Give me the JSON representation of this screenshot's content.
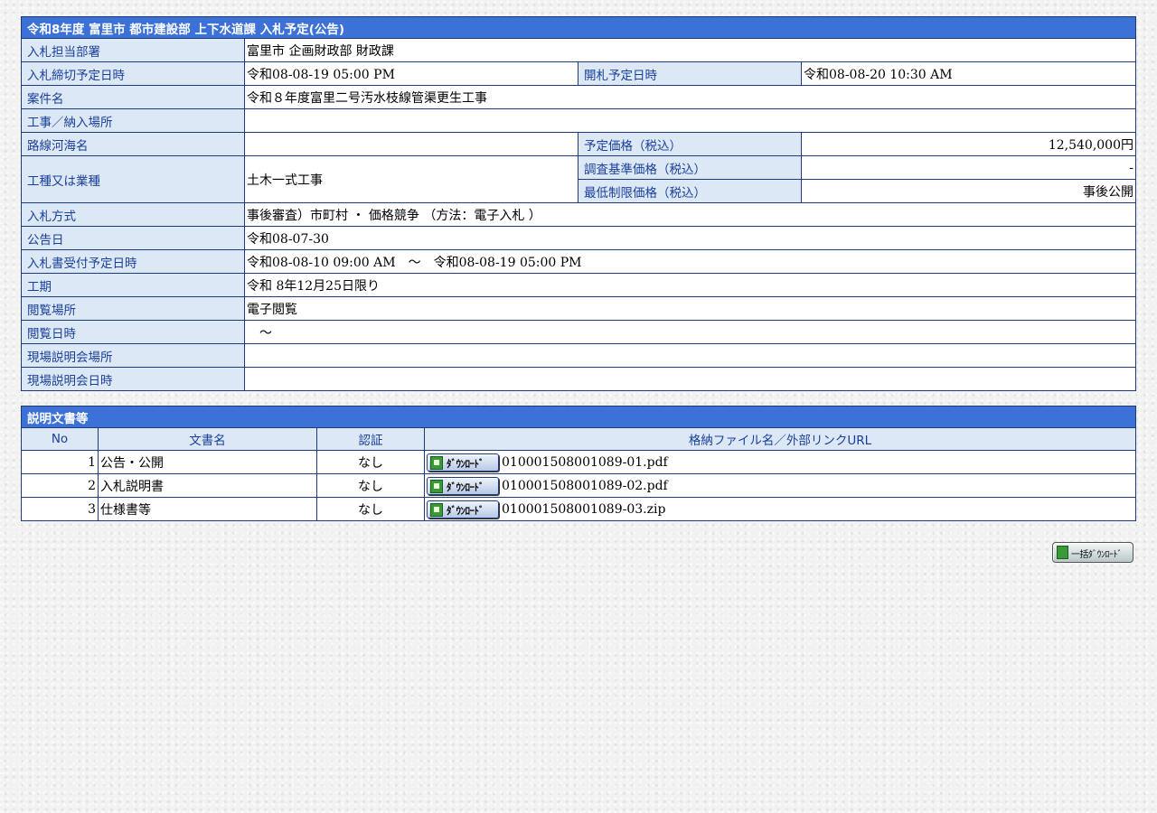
{
  "header": {
    "title": "令和8年度 富里市 都市建設部 上下水道課 入札予定(公告)"
  },
  "info": {
    "dept_label": "入札担当部署",
    "dept_value": "富里市 企画財政部 財政課",
    "deadline_label": "入札締切予定日時",
    "deadline_value": "令和08-08-19 05:00 PM",
    "opening_label": "開札予定日時",
    "opening_value": "令和08-08-20 10:30 AM",
    "project_label": "案件名",
    "project_value": "令和８年度富里二号汚水枝線管渠更生工事",
    "location_label": "工事／納入場所",
    "location_value": "",
    "route_label": "路線河海名",
    "route_value": "",
    "planned_price_label": "予定価格（税込）",
    "planned_price_value": "12,540,000円",
    "category_label": "工種又は業種",
    "category_value": "土木一式工事",
    "survey_price_label": "調査基準価格（税込）",
    "survey_price_value": "-",
    "min_price_label": "最低制限価格（税込）",
    "min_price_value": "事後公開",
    "method_label": "入札方式",
    "method_value": "事後審査）市町村 ・ 価格競争 （方法：電子入札 ）",
    "notice_date_label": "公告日",
    "notice_date_value": "令和08-07-30",
    "accept_label": "入札書受付予定日時",
    "accept_value": "令和08-08-10 09:00 AM　～　令和08-08-19 05:00 PM",
    "period_label": "工期",
    "period_value": "令和 8年12月25日限り",
    "view_place_label": "閲覧場所",
    "view_place_value": "電子閲覧",
    "view_date_label": "閲覧日時",
    "view_date_value": "　～",
    "site_place_label": "現場説明会場所",
    "site_place_value": "",
    "site_date_label": "現場説明会日時",
    "site_date_value": ""
  },
  "docs": {
    "title": "説明文書等",
    "col_no": "No",
    "col_name": "文書名",
    "col_auth": "認証",
    "col_file": "格納ファイル名／外部リンクURL",
    "download_label": "ﾀﾞｳﾝﾛｰﾄﾞ",
    "rows": [
      {
        "no": "1",
        "name": "公告・公開",
        "auth": "なし",
        "file": "010001508001089-01.pdf"
      },
      {
        "no": "2",
        "name": "入札説明書",
        "auth": "なし",
        "file": "010001508001089-02.pdf"
      },
      {
        "no": "3",
        "name": "仕様書等",
        "auth": "なし",
        "file": "010001508001089-03.zip"
      }
    ]
  },
  "bulk": {
    "label": "一括ﾀﾞｳﾝﾛｰﾄﾞ"
  }
}
